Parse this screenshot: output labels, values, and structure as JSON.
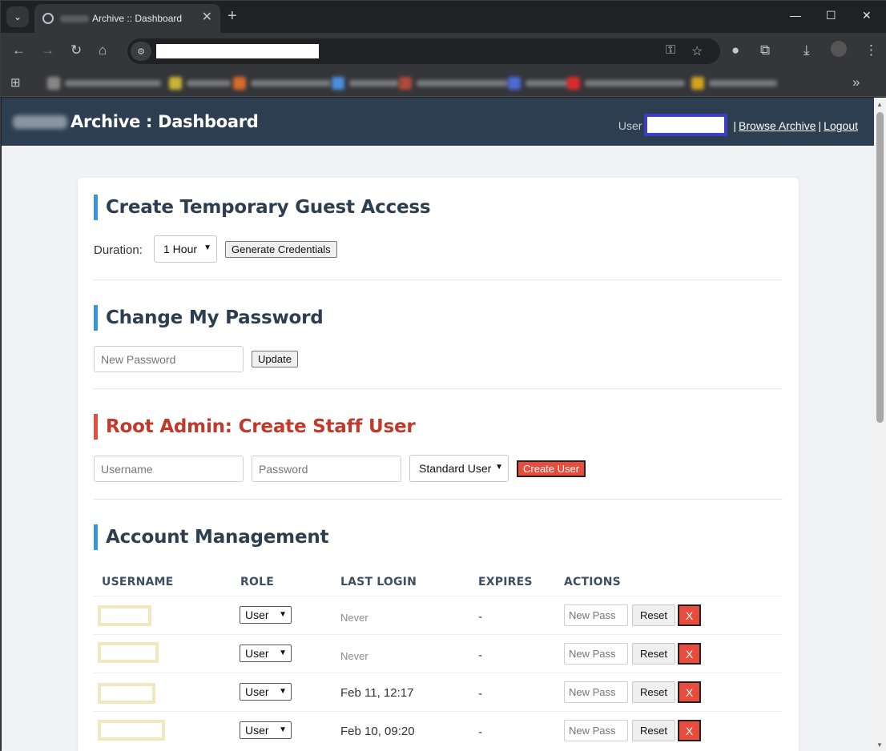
{
  "browser": {
    "tab_title": "Archive :: Dashboard",
    "new_tab_symbol": "+",
    "tab_close_symbol": "✕",
    "win_minimize": "—",
    "win_maximize": "☐",
    "win_close": "✕",
    "bookmarks_overflow": "»",
    "icons": [
      "tab-search-icon",
      "globe-icon",
      "back-icon",
      "forward-icon",
      "reload-icon",
      "home-icon",
      "site-info-icon",
      "key-icon",
      "star-icon",
      "extensions-icon",
      "puzzle-icon",
      "download-icon",
      "profile-icon",
      "menu-icon",
      "apps-icon"
    ]
  },
  "app": {
    "title": "Archive : Dashboard",
    "user_label": "User",
    "browse_link": "Browse Archive",
    "logout_link": "Logout",
    "separator": "|"
  },
  "guest_access": {
    "heading": "Create Temporary Guest Access",
    "duration_label": "Duration:",
    "duration_value": "1 Hour",
    "generate_button": "Generate Credentials"
  },
  "change_password": {
    "heading": "Change My Password",
    "new_password_placeholder": "New Password",
    "update_button": "Update"
  },
  "create_staff": {
    "heading": "Root Admin: Create Staff User",
    "username_placeholder": "Username",
    "password_placeholder": "Password",
    "role_value": "Standard User",
    "create_button": "Create User"
  },
  "accounts": {
    "heading": "Account Management",
    "columns": [
      "USERNAME",
      "ROLE",
      "LAST LOGIN",
      "EXPIRES",
      "ACTIONS"
    ],
    "rows": [
      {
        "role": "User",
        "last_login": "Never",
        "expires": "-",
        "newpass_placeholder": "New Pass",
        "reset": "Reset",
        "delete": "X"
      },
      {
        "role": "User",
        "last_login": "Never",
        "expires": "-",
        "newpass_placeholder": "New Pass",
        "reset": "Reset",
        "delete": "X"
      },
      {
        "role": "User",
        "last_login": "Feb 11, 12:17",
        "expires": "-",
        "newpass_placeholder": "New Pass",
        "reset": "Reset",
        "delete": "X"
      },
      {
        "role": "User",
        "last_login": "Feb 10, 09:20",
        "expires": "-",
        "newpass_placeholder": "New Pass",
        "reset": "Reset",
        "delete": "X"
      }
    ]
  },
  "colors": {
    "header_bg": "#2c3e50",
    "accent_blue": "#3498db",
    "danger_red": "#e74c3c",
    "danger_text": "#c0392b",
    "page_bg": "#f0f2f5"
  }
}
